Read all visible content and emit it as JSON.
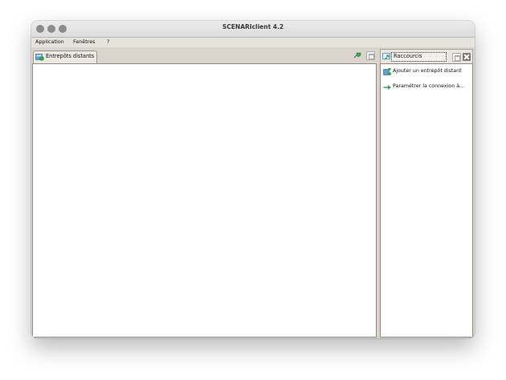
{
  "window": {
    "title": "SCENARIclient 4.2"
  },
  "menu": {
    "application": "Application",
    "windows": "Fenêtres",
    "help": "?"
  },
  "left_panel": {
    "tab_label": "Entrepôts distants",
    "tab_icon": "repository-icon",
    "toolbar_icons": [
      "pin-icon",
      "maximize-icon"
    ]
  },
  "right_panel": {
    "tab_label": "Raccourcis",
    "icons": [
      "shortcuts-icon",
      "maximize-icon",
      "close-icon"
    ],
    "items": [
      {
        "label": "Ajouter un entrepôt distant",
        "icon": "add-repository-icon"
      },
      {
        "label": "Paramétrer la connexion à...",
        "icon": "arrow-right-icon"
      }
    ]
  },
  "colors": {
    "accent_green": "#3aa64a",
    "accent_blue": "#2f76c7",
    "panel_bg": "#d9d5cd"
  }
}
